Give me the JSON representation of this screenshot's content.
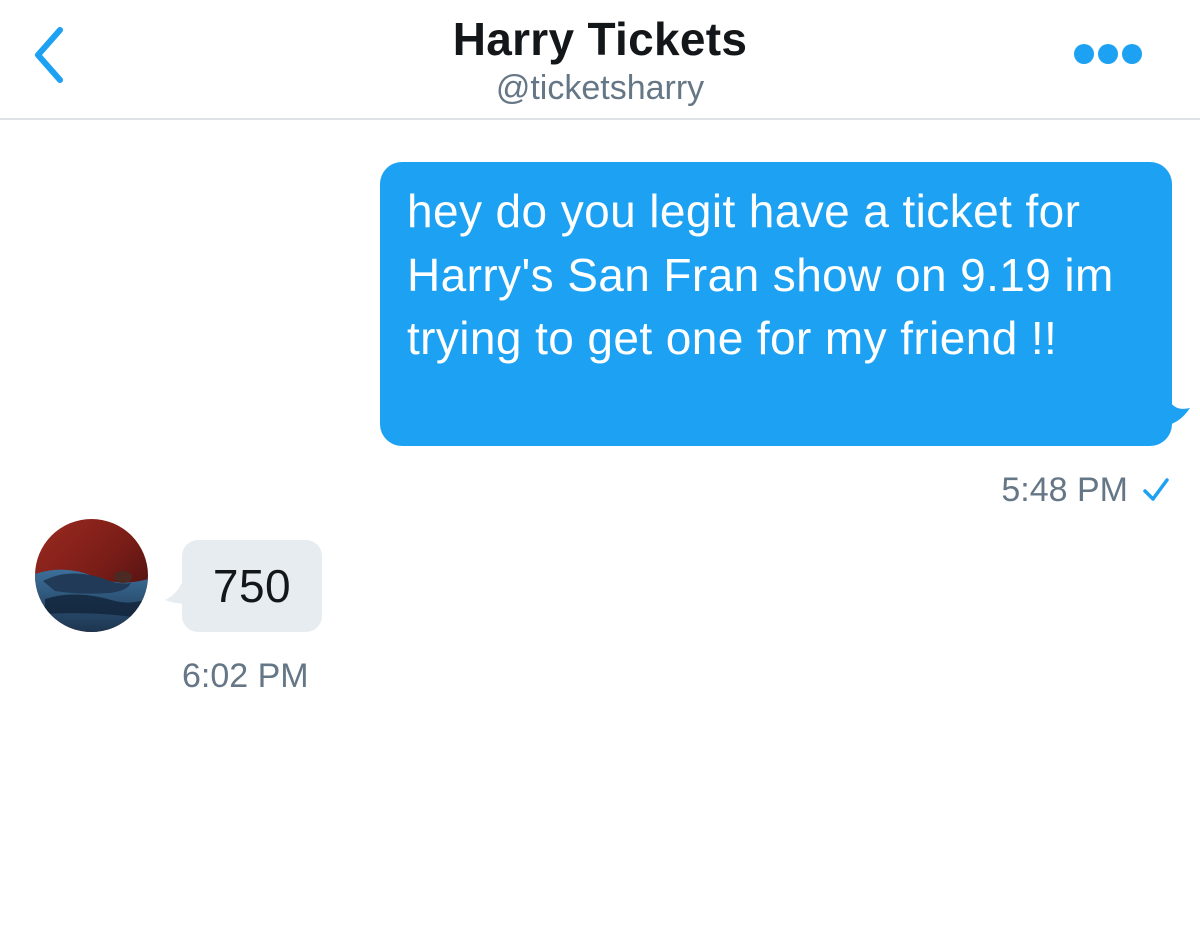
{
  "header": {
    "title": "Harry Tickets",
    "handle": "@ticketsharry",
    "back_icon": "chevron-left-icon",
    "more_icon": "ellipsis-icon"
  },
  "messages": [
    {
      "direction": "sent",
      "text": "hey do you legit have a ticket for Harry's San Fran show on 9.19 im trying to get one for my friend !!",
      "time": "5:48 PM",
      "status_icon": "checkmark-icon"
    },
    {
      "direction": "received",
      "text": "750",
      "time": "6:02 PM",
      "avatar_icon": "avatar"
    }
  ],
  "colors": {
    "accent": "#1da1f2",
    "received_bubble": "#e6ecf0",
    "muted_text": "#657786",
    "primary_text": "#14171a",
    "divider": "#dfe3e7"
  }
}
